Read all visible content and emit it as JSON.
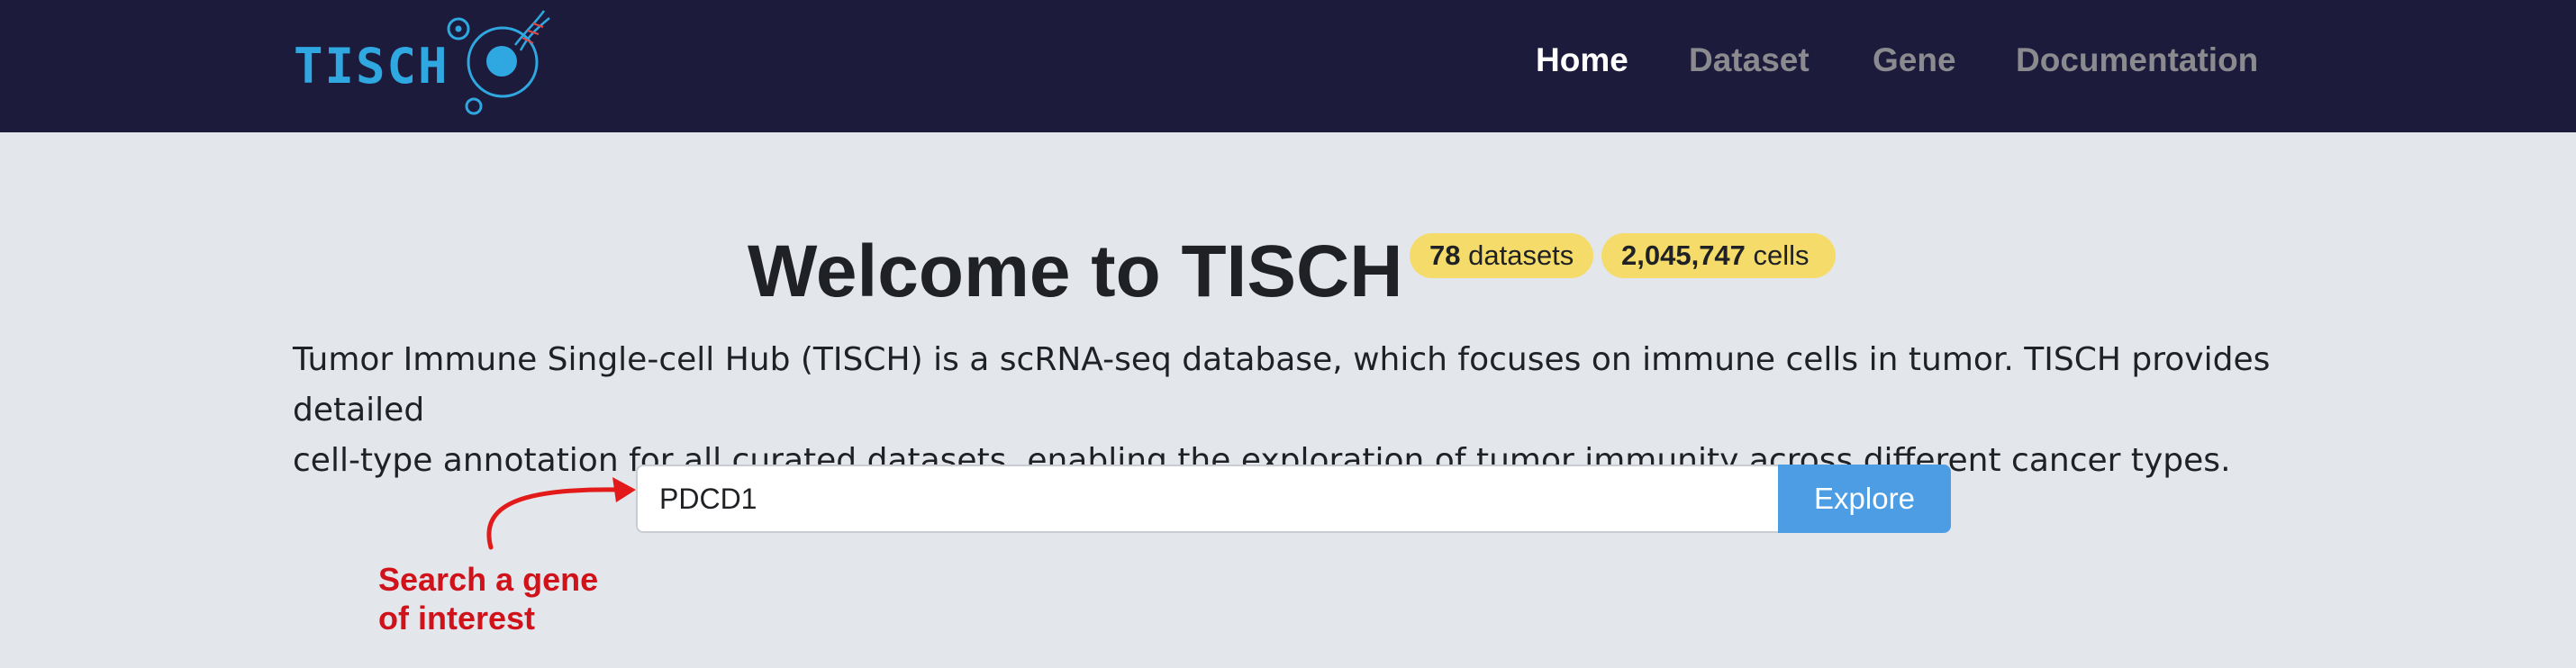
{
  "brand": {
    "logo_text": "TISCH",
    "logo_color": "#2fa7e0"
  },
  "nav": {
    "items": [
      {
        "label": "Home",
        "active": true
      },
      {
        "label": "Dataset",
        "active": false
      },
      {
        "label": "Gene",
        "active": false
      },
      {
        "label": "Documentation",
        "active": false
      }
    ],
    "background": "#1c1b3c"
  },
  "hero": {
    "title": "Welcome to TISCH",
    "badges": [
      {
        "value": "78",
        "unit": "datasets"
      },
      {
        "value": "2,045,747",
        "unit": "cells"
      }
    ],
    "badge_color": "#f5dc6a",
    "description_line1": "Tumor Immune Single-cell Hub (TISCH) is a scRNA-seq database, which focuses on immune cells in tumor. TISCH provides detailed",
    "description_line2": "cell-type annotation for all curated datasets, enabling the exploration of tumor immunity across different cancer types."
  },
  "search": {
    "value": "PDCD1",
    "button_label": "Explore",
    "button_color": "#4c9de4"
  },
  "annotation": {
    "line1": "Search a gene",
    "line2": "of interest",
    "color": "#d0121b"
  }
}
